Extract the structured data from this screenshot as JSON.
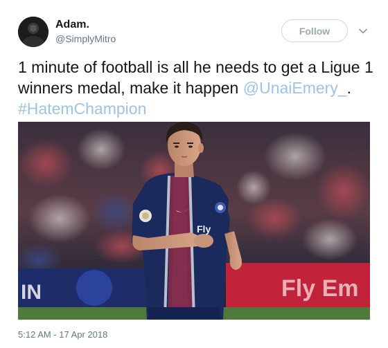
{
  "user": {
    "display_name": "Adam.",
    "handle": "@SimplyMitro",
    "avatar_icon": "user-avatar"
  },
  "follow_button": {
    "label": "Follow"
  },
  "menu": {
    "icon": "chevron-down-icon"
  },
  "tweet": {
    "text_plain": "1 minute of football is all he needs to get a Ligue 1 winners medal, make it happen ",
    "mention": "@UnaiEmery_",
    "separator": ". ",
    "hashtag": "#HatemChampion"
  },
  "media": {
    "description_icon": "photo",
    "sponsor_text": "Fly Em",
    "board_left_text": "IN",
    "shirt_text": "Fly"
  },
  "timestamp": "5:12 AM - 17 Apr 2018",
  "colors": {
    "link": "#9bc4e6",
    "kit_navy": "#1b2a5c",
    "kit_red": "#7a2a4a",
    "board_red": "#c0233a"
  }
}
